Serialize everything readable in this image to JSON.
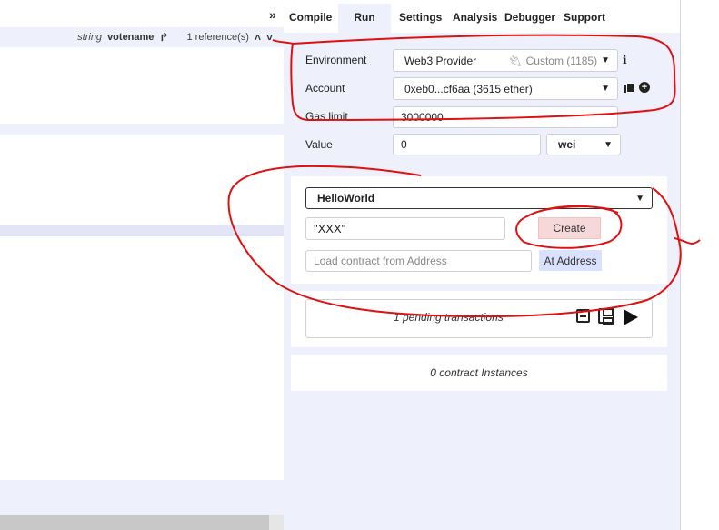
{
  "editor": {
    "reference_type": "string",
    "reference_name": "votename",
    "reference_count": "1 reference(s)"
  },
  "tabs": {
    "compile": "Compile",
    "run": "Run",
    "settings": "Settings",
    "analysis": "Analysis",
    "debugger": "Debugger",
    "support": "Support"
  },
  "run": {
    "environment_label": "Environment",
    "environment_value": "Web3 Provider",
    "environment_network": "Custom (1185)",
    "account_label": "Account",
    "account_value": "0xeb0...cf6aa (3615 ether)",
    "gas_limit_label": "Gas limit",
    "gas_limit_value": "3000000",
    "value_label": "Value",
    "value_value": "0",
    "value_unit": "wei",
    "contract_selected": "HelloWorld",
    "constructor_args": "\"XXX\"",
    "create_label": "Create",
    "load_placeholder": "Load contract from Address",
    "at_address_label": "At Address",
    "pending_text": "1 pending transactions",
    "instances_text": "0 contract Instances"
  },
  "colors": {
    "panel_bg": "#eef0fb",
    "create_btn_bg": "#f7d8d8",
    "at_address_bg": "#d9e1ff",
    "annotation_red": "#e01010"
  },
  "icons": [
    "chevron-double-right-icon",
    "share-icon",
    "chevron-up-icon",
    "chevron-down-icon",
    "plug-icon",
    "info-icon",
    "copy-icon",
    "plus-circle-icon",
    "minus-square-icon",
    "save-icon",
    "play-icon"
  ]
}
